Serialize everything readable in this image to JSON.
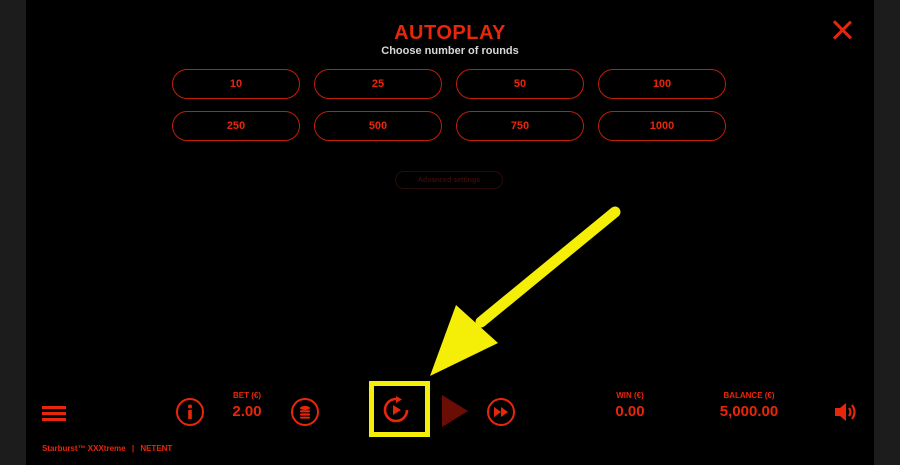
{
  "header": {
    "title": "AUTOPLAY",
    "subtitle": "Choose number of rounds"
  },
  "rounds": [
    "10",
    "25",
    "50",
    "100",
    "250",
    "500",
    "750",
    "1000"
  ],
  "advanced_label": "Advanced settings",
  "bottom_bar": {
    "bet_label": "BET (€)",
    "bet_value": "2.00",
    "win_label": "WIN (€)",
    "win_value": "0.00",
    "balance_label": "BALANCE (€)",
    "balance_value": "5,000.00"
  },
  "footer": {
    "game_name": "Starburst™ XXXtreme",
    "separator": "|",
    "provider": "NETENT"
  },
  "colors": {
    "accent": "#e8260a",
    "highlight": "#f5ef08",
    "background": "#000000"
  },
  "icons": [
    "close-icon",
    "menu-icon",
    "info-icon",
    "coin-stack-icon",
    "autoplay-icon",
    "play-icon",
    "fast-forward-icon",
    "speaker-icon"
  ]
}
